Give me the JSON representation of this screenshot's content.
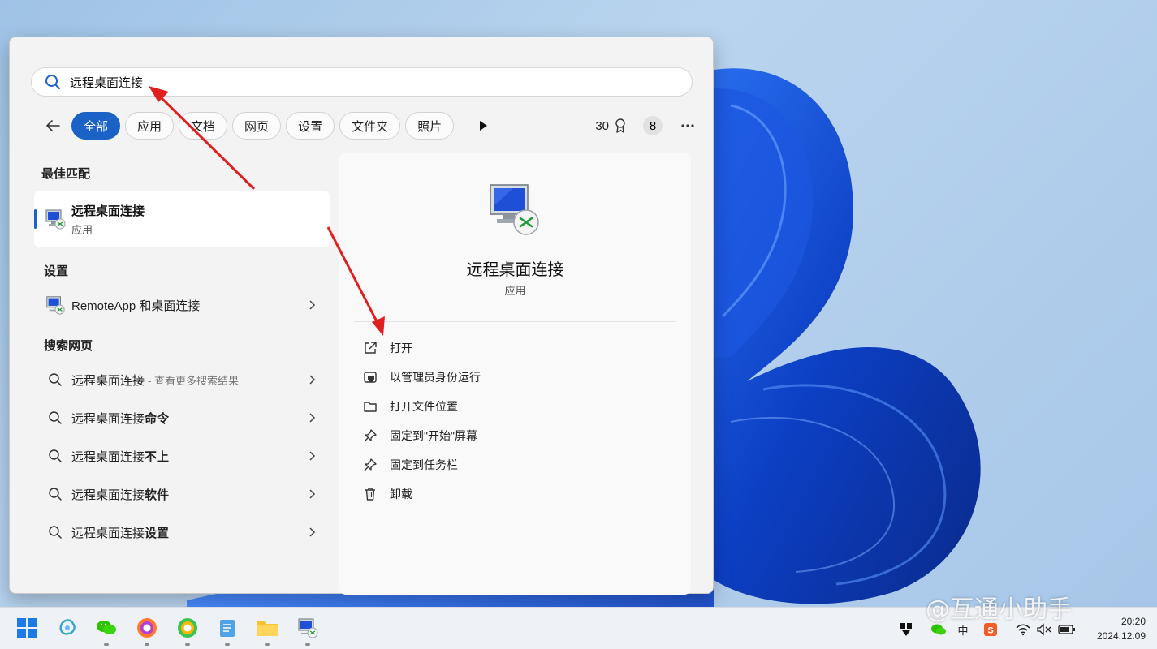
{
  "search": {
    "query": "远程桌面连接"
  },
  "filters": {
    "chips": [
      "全部",
      "应用",
      "文档",
      "网页",
      "设置",
      "文件夹",
      "照片"
    ],
    "points": "30",
    "badge": "8"
  },
  "left": {
    "best_match_title": "最佳匹配",
    "best_match": {
      "name": "远程桌面连接",
      "type": "应用"
    },
    "settings_title": "设置",
    "settings_item": "RemoteApp 和桌面连接",
    "web_title": "搜索网页",
    "web_items": [
      {
        "base": "远程桌面连接",
        "bold": "",
        "sub": "- 查看更多搜索结果"
      },
      {
        "base": "远程桌面连接",
        "bold": "命令",
        "sub": ""
      },
      {
        "base": "远程桌面连接",
        "bold": "不上",
        "sub": ""
      },
      {
        "base": "远程桌面连接",
        "bold": "软件",
        "sub": ""
      },
      {
        "base": "远程桌面连接",
        "bold": "设置",
        "sub": ""
      }
    ]
  },
  "preview": {
    "title": "远程桌面连接",
    "type": "应用",
    "actions": [
      "打开",
      "以管理员身份运行",
      "打开文件位置",
      "固定到\"开始\"屏幕",
      "固定到任务栏",
      "卸载"
    ]
  },
  "taskbar": {
    "time": "20:20",
    "date": "2024.12.09",
    "ime": "中"
  },
  "watermark": "@互通小助手",
  "colors": {
    "accent": "#1a62c5",
    "arrow": "#e0201e"
  }
}
